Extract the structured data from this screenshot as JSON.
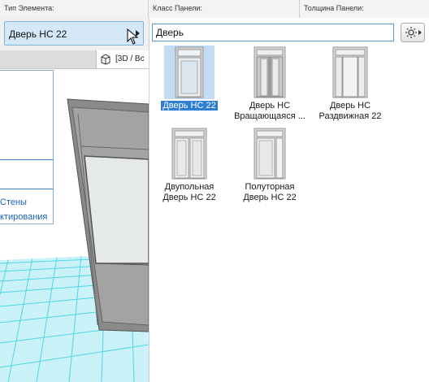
{
  "header": {
    "element_type_label": "Тип Элемента:",
    "panel_class_label": "Класс Панели:",
    "panel_thickness_label": "Толщина Панели:"
  },
  "type_selector": {
    "value": "Дверь НС 22"
  },
  "view_tab": {
    "label": "[3D / Вс"
  },
  "info_panel": {
    "link1": "Стены",
    "link2": "ктирования"
  },
  "search": {
    "value": "Дверь"
  },
  "gallery": {
    "items": [
      {
        "label": "Дверь НС 22",
        "selected": true
      },
      {
        "label": "Дверь НС\nВращающаяся ...",
        "selected": false
      },
      {
        "label": "Дверь НС\nРаздвижная 22",
        "selected": false
      },
      {
        "label": "Двупольная\nДверь НС 22",
        "selected": false
      },
      {
        "label": "Полуторная\nДверь НС 22",
        "selected": false
      }
    ]
  },
  "colors": {
    "accent": "#2e7fd2",
    "selection_bg": "#c3dbf3",
    "grid": "#4fd5e8"
  }
}
